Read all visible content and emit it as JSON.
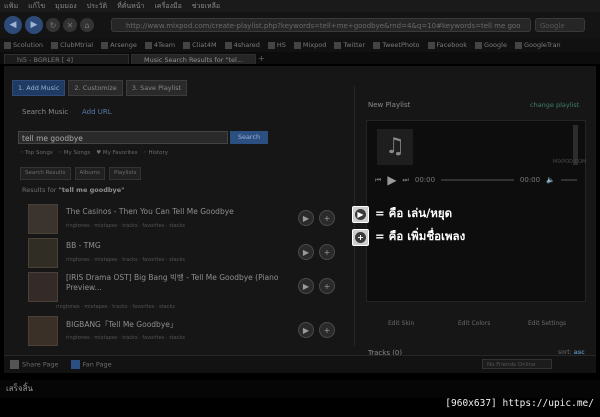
{
  "menubar": {
    "items": [
      "แฟ้ม",
      "แก้ไข",
      "มุมมอง",
      "ประวัติ",
      "ที่คั่นหน้า",
      "เครื่องมือ",
      "ช่วยเหลือ"
    ]
  },
  "nav": {
    "url": "http://www.mixpod.com/create-playlist.php?keywords=tell+me+goodbye&rnd=4&q=10#keywords=tell me goo",
    "search_placeholder": "Google"
  },
  "bookmarks": [
    "Scolution",
    "ClubMtrial",
    "Arsenge",
    "4Team",
    "Cliat4M",
    "4shared",
    "HS",
    "Mixpod",
    "Twitter",
    "TweetPhoto",
    "Facebook",
    "Google",
    "GoogleTran"
  ],
  "tabs": [
    {
      "label": "hi5 - BGRLER [ 4] ",
      "active": false
    },
    {
      "label": "Music Search Results for \"tel...",
      "active": true
    }
  ],
  "steps": [
    "1. Add Music",
    "2. Customize",
    "3. Save Playlist"
  ],
  "search": {
    "label": "Search Music",
    "add_url": "Add URL",
    "query": "tell me goodbye",
    "button": "Search",
    "filters": [
      "Top Songs",
      "My Songs",
      "My Favorites",
      "History"
    ]
  },
  "subtabs": [
    "Search Results",
    "Albums",
    "Playlists"
  ],
  "results_prefix": "Results for ",
  "results_query": "\"tell me goodbye\"",
  "results": [
    {
      "title": "The Casinos - Then You Can Tell Me Goodbye",
      "meta": "ringtones · mixtapes · tracks · favorites · stacks"
    },
    {
      "title": "BB - TMG",
      "meta": "ringtones · mixtapes · tracks · favorites · stacks"
    },
    {
      "title": "[IRIS Drama OST] Big Bang 빅뱅 - Tell Me Goodbye (Piano Preview...",
      "meta": "ringtones · mixtapes · tracks · favorites · stacks"
    },
    {
      "title": "BIGBANG「Tell Me Goodbye」",
      "meta": "ringtones · mixtapes · tracks · favorites · stacks"
    }
  ],
  "playlist": {
    "title": "New Playlist",
    "change_link": "change playlist",
    "brand": "MIXPOD.COM",
    "time_start": "00:00",
    "time_end": "00:00",
    "edit_labels": [
      "Edit Skin",
      "Edit Colors",
      "Edit Settings"
    ],
    "tracks_label": "Tracks (0)",
    "sort_label": "sort:",
    "sort_value": "asc"
  },
  "legend": [
    {
      "icon": "▶",
      "text": "= คือ เล่น/หยุด"
    },
    {
      "icon": "+",
      "text": "= คือ เพิ่มชื่อเพลง"
    }
  ],
  "fbbar": {
    "share": "Share Page",
    "fan": "Fan Page",
    "friends": "No Friends Online"
  },
  "status": "เสร็จสิ้น",
  "watermark": "[960x637] https://upic.me/"
}
